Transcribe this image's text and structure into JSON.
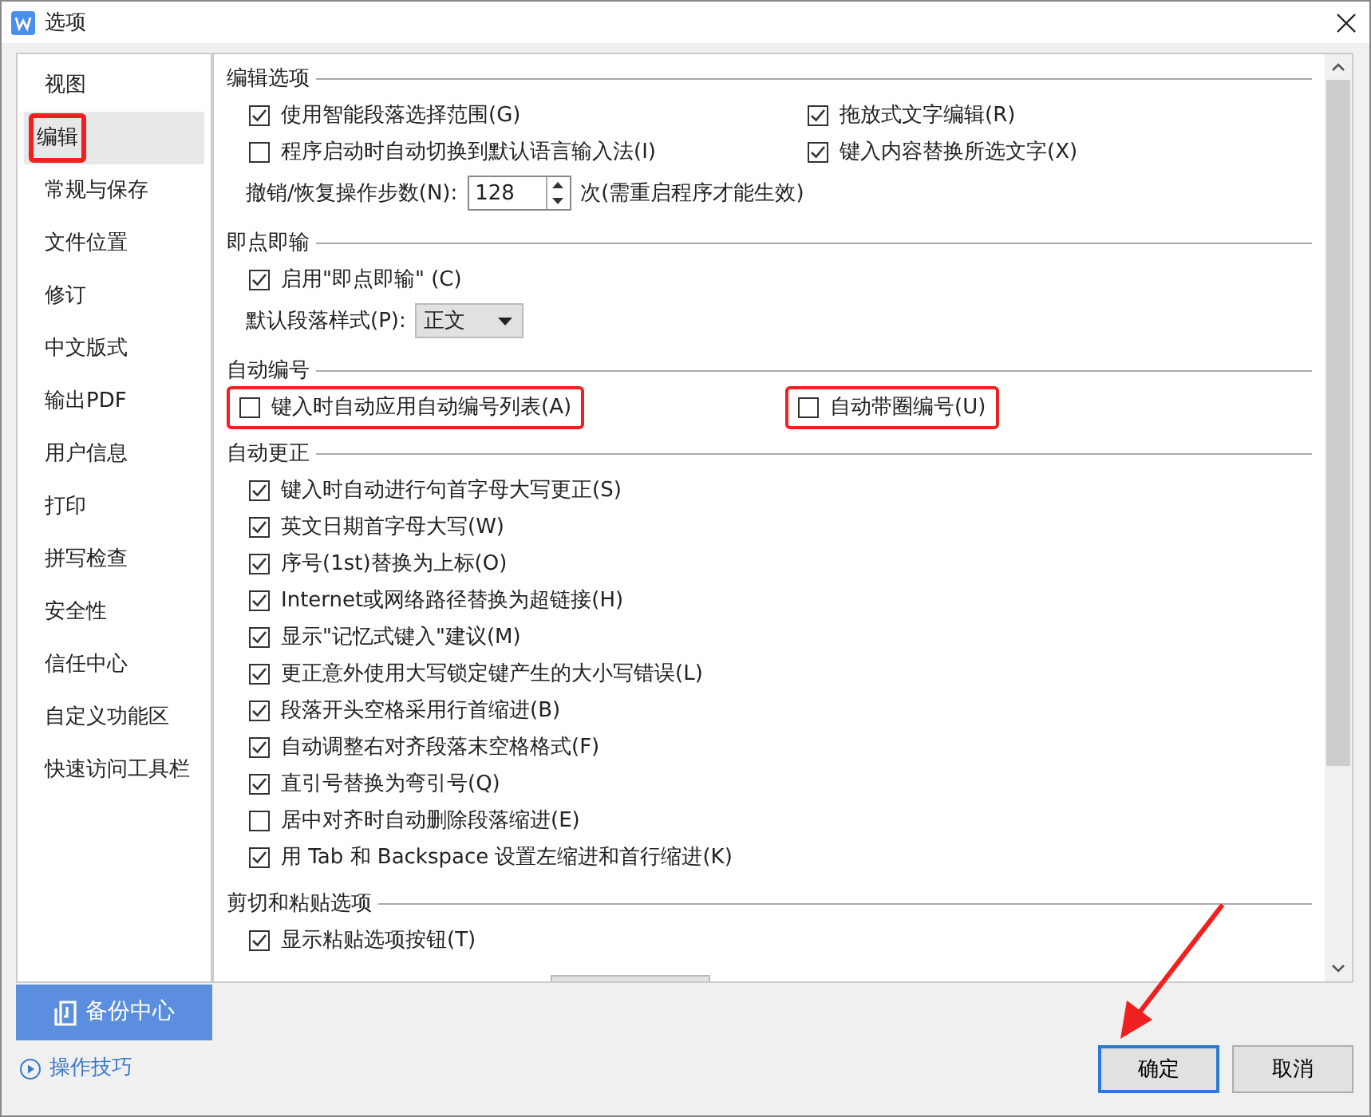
{
  "window": {
    "title": "选项"
  },
  "sidebar": {
    "items": [
      {
        "label": "视图",
        "selected": false,
        "highlighted": false
      },
      {
        "label": "编辑",
        "selected": true,
        "highlighted": true
      },
      {
        "label": "常规与保存",
        "selected": false,
        "highlighted": false
      },
      {
        "label": "文件位置",
        "selected": false,
        "highlighted": false
      },
      {
        "label": "修订",
        "selected": false,
        "highlighted": false
      },
      {
        "label": "中文版式",
        "selected": false,
        "highlighted": false
      },
      {
        "label": "输出PDF",
        "selected": false,
        "highlighted": false
      },
      {
        "label": "用户信息",
        "selected": false,
        "highlighted": false
      },
      {
        "label": "打印",
        "selected": false,
        "highlighted": false
      },
      {
        "label": "拼写检查",
        "selected": false,
        "highlighted": false
      },
      {
        "label": "安全性",
        "selected": false,
        "highlighted": false
      },
      {
        "label": "信任中心",
        "selected": false,
        "highlighted": false
      },
      {
        "label": "自定义功能区",
        "selected": false,
        "highlighted": false
      },
      {
        "label": "快速访问工具栏",
        "selected": false,
        "highlighted": false
      }
    ],
    "backup_button": "备份中心",
    "tips_link": "操作技巧"
  },
  "sections": [
    {
      "title": "编辑选项",
      "rows": [
        [
          {
            "kind": "checkbox",
            "label": "使用智能段落选择范围(G)",
            "checked": true,
            "highlighted": false
          },
          {
            "kind": "checkbox",
            "label": "拖放式文字编辑(R)",
            "checked": true,
            "highlighted": false
          }
        ],
        [
          {
            "kind": "checkbox",
            "label": "程序启动时自动切换到默认语言输入法(I)",
            "checked": false,
            "highlighted": false
          },
          {
            "kind": "checkbox",
            "label": "键入内容替换所选文字(X)",
            "checked": true,
            "highlighted": false
          }
        ],
        [
          {
            "kind": "spinner",
            "label": "撤销/恢复操作步数(N):",
            "value": "128",
            "note": "次(需重启程序才能生效)"
          }
        ]
      ]
    },
    {
      "title": "即点即输",
      "rows": [
        [
          {
            "kind": "checkbox",
            "label": "启用\"即点即输\" (C)",
            "checked": true,
            "highlighted": false
          }
        ],
        [
          {
            "kind": "dropdown",
            "label": "默认段落样式(P):",
            "value": "正文"
          }
        ]
      ]
    },
    {
      "title": "自动编号",
      "rows": [
        [
          {
            "kind": "checkbox",
            "label": "键入时自动应用自动编号列表(A)",
            "checked": false,
            "highlighted": true
          },
          {
            "kind": "checkbox",
            "label": "自动带圈编号(U)",
            "checked": false,
            "highlighted": true
          }
        ]
      ]
    },
    {
      "title": "自动更正",
      "rows": [
        [
          {
            "kind": "checkbox",
            "label": "键入时自动进行句首字母大写更正(S)",
            "checked": true,
            "highlighted": false
          }
        ],
        [
          {
            "kind": "checkbox",
            "label": "英文日期首字母大写(W)",
            "checked": true,
            "highlighted": false
          }
        ],
        [
          {
            "kind": "checkbox",
            "label": "序号(1st)替换为上标(O)",
            "checked": true,
            "highlighted": false
          }
        ],
        [
          {
            "kind": "checkbox",
            "label": "Internet或网络路径替换为超链接(H)",
            "checked": true,
            "highlighted": false
          }
        ],
        [
          {
            "kind": "checkbox",
            "label": "显示\"记忆式键入\"建议(M)",
            "checked": true,
            "highlighted": false
          }
        ],
        [
          {
            "kind": "checkbox",
            "label": "更正意外使用大写锁定键产生的大小写错误(L)",
            "checked": true,
            "highlighted": false
          }
        ],
        [
          {
            "kind": "checkbox",
            "label": "段落开头空格采用行首缩进(B)",
            "checked": true,
            "highlighted": false
          }
        ],
        [
          {
            "kind": "checkbox",
            "label": "自动调整右对齐段落末空格格式(F)",
            "checked": true,
            "highlighted": false
          }
        ],
        [
          {
            "kind": "checkbox",
            "label": "直引号替换为弯引号(Q)",
            "checked": true,
            "highlighted": false
          }
        ],
        [
          {
            "kind": "checkbox",
            "label": "居中对齐时自动删除段落缩进(E)",
            "checked": false,
            "highlighted": false
          }
        ],
        [
          {
            "kind": "checkbox",
            "label": "用 Tab 和 Backspace 设置左缩进和首行缩进(K)",
            "checked": true,
            "highlighted": false
          }
        ]
      ]
    },
    {
      "title": "剪切和粘贴选项",
      "rows": [
        [
          {
            "kind": "checkbox",
            "label": "显示粘贴选项按钮(T)",
            "checked": true,
            "highlighted": false
          }
        ],
        [
          {
            "kind": "partial_button"
          }
        ]
      ]
    }
  ],
  "buttons": [
    {
      "label": "确定",
      "kind": "default",
      "arrow": true
    },
    {
      "label": "取消",
      "kind": "normal"
    }
  ]
}
